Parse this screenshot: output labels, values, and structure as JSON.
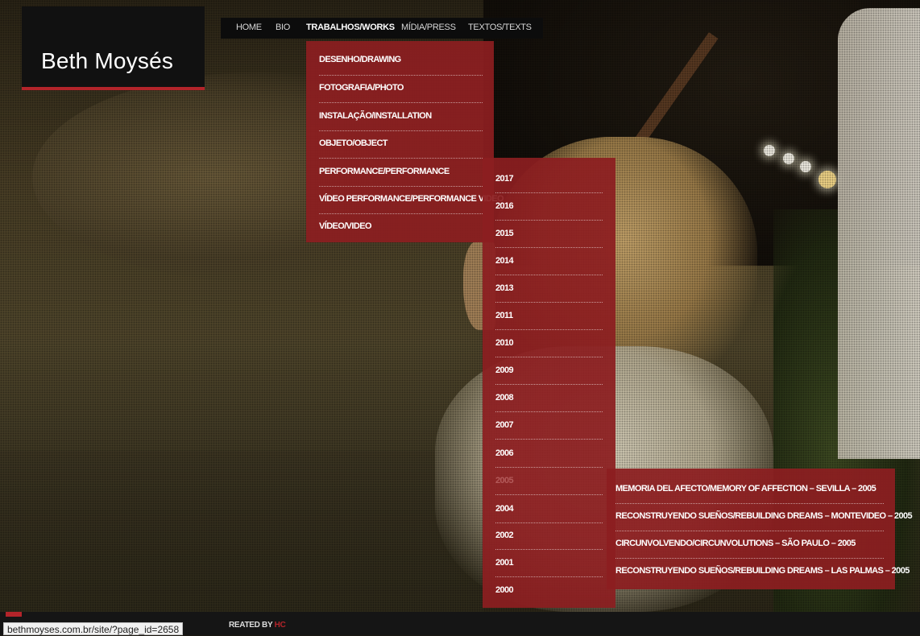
{
  "logo": {
    "text": "Beth Moysés"
  },
  "nav": {
    "items": [
      "HOME",
      "BIO",
      "TRABALHOS/WORKS",
      "MÍDIA/PRESS",
      "TEXTOS/TEXTS"
    ],
    "active": "TRABALHOS/WORKS"
  },
  "works_menu": {
    "items": [
      "DESENHO/DRAWING",
      "FOTOGRAFIA/PHOTO",
      "INSTALAÇÃO/INSTALLATION",
      "OBJETO/OBJECT",
      "PERFORMANCE/PERFORMANCE",
      "VÍDEO PERFORMANCE/PERFORMANCE VIDEO",
      "VÍDEO/VIDEO"
    ]
  },
  "years_menu": {
    "items": [
      "2017",
      "2016",
      "2015",
      "2014",
      "2013",
      "2011",
      "2010",
      "2009",
      "2008",
      "2007",
      "2006",
      "2005",
      "2004",
      "2002",
      "2001",
      "2000"
    ],
    "hovered": "2005"
  },
  "year_2005_menu": {
    "items": [
      "MEMORIA DEL AFECTO/MEMORY OF AFFECTION – SEVILLA – 2005",
      "RECONSTRUYENDO SUEÑOS/REBUILDING DREAMS – MONTEVIDEO – 2005",
      "CIRCUNVOLVENDO/CIRCUNVOLUTIONS – SÃO PAULO – 2005",
      "RECONSTRUYENDO SUEÑOS/REBUILDING DREAMS – LAS PALMAS – 2005"
    ]
  },
  "footer": {
    "credit_prefix": "REATED BY",
    "credit_brand": "HC"
  },
  "status_bar": {
    "url": "bethmoyses.com.br/site/?page_id=2658"
  },
  "colors": {
    "accent": "#b3242a",
    "menu_bg": "#8c1e20",
    "nav_bg": "#0c0c0c"
  }
}
